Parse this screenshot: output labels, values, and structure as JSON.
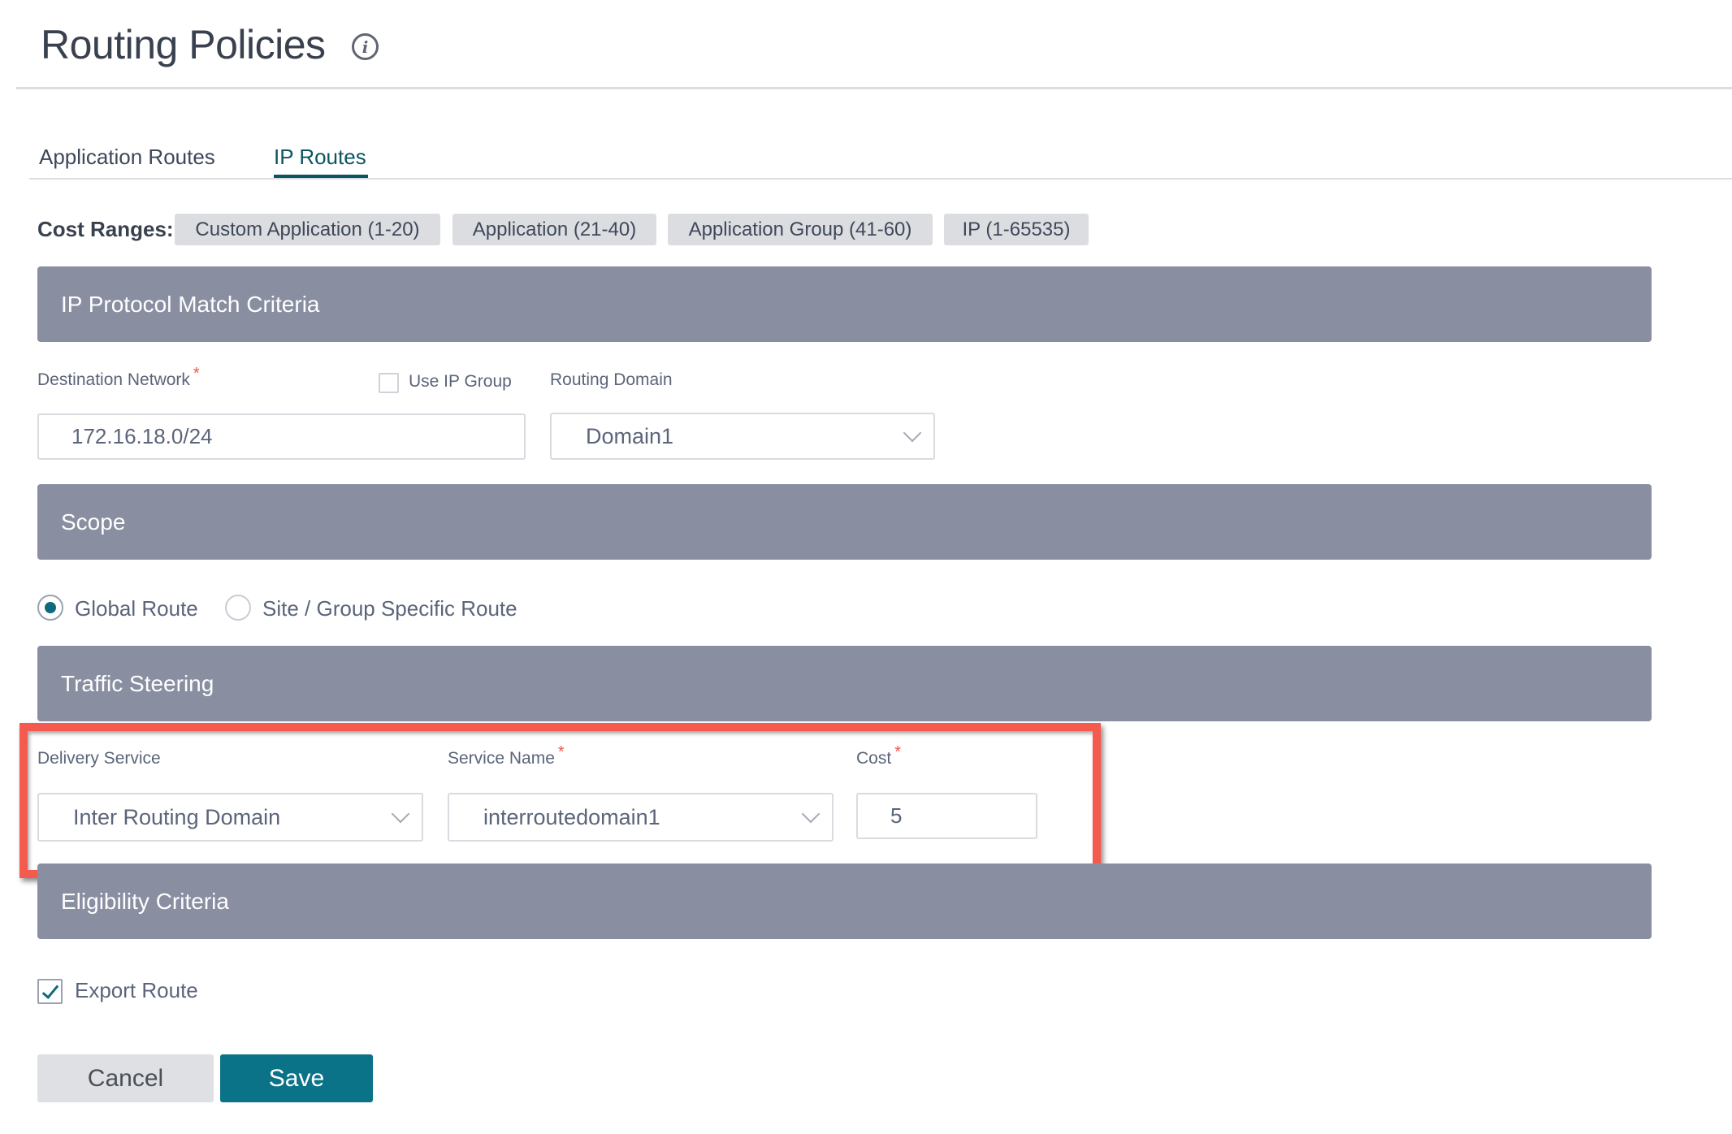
{
  "header": {
    "title": "Routing Policies",
    "info_icon": "info-icon"
  },
  "tabs": [
    {
      "label": "Application Routes",
      "active": false
    },
    {
      "label": "IP Routes",
      "active": true
    }
  ],
  "cost_ranges": {
    "label": "Cost Ranges:",
    "chips": [
      "Custom Application (1-20)",
      "Application (21-40)",
      "Application Group (41-60)",
      "IP (1-65535)"
    ]
  },
  "sections": {
    "ip_protocol": {
      "title": "IP Protocol Match Criteria",
      "destination_network": {
        "label": "Destination Network",
        "required_mark": "*",
        "value": "172.16.18.0/24"
      },
      "use_ip_group": {
        "label": "Use IP Group",
        "checked": false
      },
      "routing_domain": {
        "label": "Routing Domain",
        "value": "Domain1"
      }
    },
    "scope": {
      "title": "Scope",
      "options": [
        {
          "label": "Global Route",
          "selected": true
        },
        {
          "label": "Site / Group Specific Route",
          "selected": false
        }
      ]
    },
    "traffic_steering": {
      "title": "Traffic Steering",
      "delivery_service": {
        "label": "Delivery Service",
        "value": "Inter Routing Domain"
      },
      "service_name": {
        "label": "Service Name",
        "required_mark": "*",
        "value": "interroutedomain1"
      },
      "cost": {
        "label": "Cost",
        "required_mark": "*",
        "value": "5"
      }
    },
    "eligibility": {
      "title": "Eligibility Criteria",
      "export_route": {
        "label": "Export Route",
        "checked": true
      }
    }
  },
  "actions": {
    "cancel": "Cancel",
    "save": "Save"
  },
  "colors": {
    "accent": "#0b7388",
    "active_tab": "#0b5560",
    "section_bar": "#898ea1",
    "highlight": "#f55a4e",
    "required": "#f0564b"
  }
}
